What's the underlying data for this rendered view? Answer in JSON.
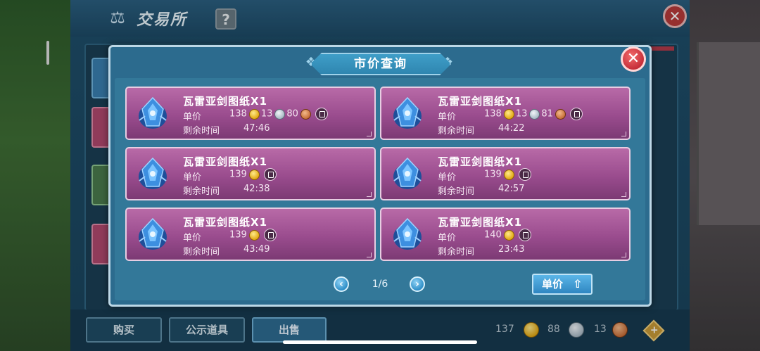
{
  "main": {
    "title": "交易所",
    "help_label": "?",
    "close_label": "✕",
    "tabs": [
      {
        "label": "购买"
      },
      {
        "label": "公示道具"
      },
      {
        "label": "出售"
      }
    ],
    "currency": {
      "gold": "137",
      "silver": "88",
      "copper": "13",
      "add_label": "+"
    }
  },
  "modal": {
    "title": "市价查询",
    "close_label": "✕",
    "price_label": "单价",
    "time_label": "剩余时间",
    "cards": [
      {
        "name": "瓦雷亚剑图纸X1",
        "gold": "138",
        "silver": "13",
        "copper": "80",
        "time": "47:46"
      },
      {
        "name": "瓦雷亚剑图纸X1",
        "gold": "138",
        "silver": "13",
        "copper": "81",
        "time": "44:22"
      },
      {
        "name": "瓦雷亚剑图纸X1",
        "gold": "139",
        "time": "42:38"
      },
      {
        "name": "瓦雷亚剑图纸X1",
        "gold": "139",
        "time": "42:57"
      },
      {
        "name": "瓦雷亚剑图纸X1",
        "gold": "139",
        "time": "43:49"
      },
      {
        "name": "瓦雷亚剑图纸X1",
        "gold": "140",
        "time": "23:43"
      }
    ],
    "pager": {
      "prev": "‹",
      "next": "›",
      "page": "1/6"
    },
    "sort_button": {
      "label": "单价"
    }
  },
  "colors": {
    "card_top": "#b86aa7",
    "card_bottom": "#7c3a74",
    "modal_bg": "#2c6b8e",
    "accent_blue": "#2f86c1"
  }
}
